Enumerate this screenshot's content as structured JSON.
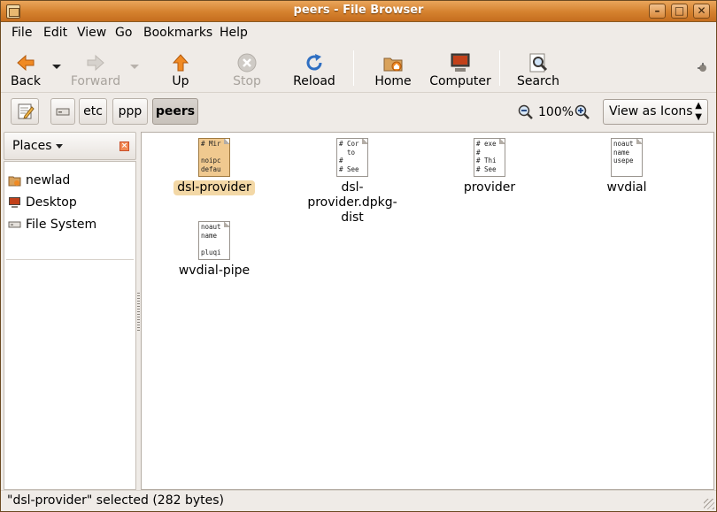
{
  "window": {
    "title": "peers - File Browser"
  },
  "menu": [
    {
      "label": "File"
    },
    {
      "label": "Edit"
    },
    {
      "label": "View"
    },
    {
      "label": "Go"
    },
    {
      "label": "Bookmarks"
    },
    {
      "label": "Help"
    }
  ],
  "toolbar": {
    "back": "Back",
    "forward": "Forward",
    "up": "Up",
    "stop": "Stop",
    "reload": "Reload",
    "home": "Home",
    "computer": "Computer",
    "search": "Search"
  },
  "location": {
    "crumbs": [
      "etc",
      "ppp",
      "peers"
    ],
    "zoom": "100%",
    "view_mode": "View as Icons"
  },
  "sidebar": {
    "header": "Places",
    "items": [
      {
        "label": "newlad",
        "icon": "home-folder-icon"
      },
      {
        "label": "Desktop",
        "icon": "desktop-icon"
      },
      {
        "label": "File System",
        "icon": "drive-icon"
      }
    ]
  },
  "files": [
    {
      "name": "dsl-provider",
      "preview": "# Mir\n\nnoipc\ndefau",
      "selected": true
    },
    {
      "name": "dsl-provider.dpkg-dist",
      "preview": "# Cor\n  to\n#\n# See",
      "selected": false
    },
    {
      "name": "provider",
      "preview": "# exe\n#\n# Thi\n# See",
      "selected": false
    },
    {
      "name": "wvdial",
      "preview": "noaut\nname\nusepe",
      "selected": false
    },
    {
      "name": "wvdial-pipe",
      "preview": "noaut\nname\n\npluqi",
      "selected": false
    }
  ],
  "status": "\"dsl-provider\" selected (282 bytes)",
  "colors": {
    "titlebar": "#d5812e",
    "selection": "#f3d8a6",
    "background": "#efebe7"
  }
}
